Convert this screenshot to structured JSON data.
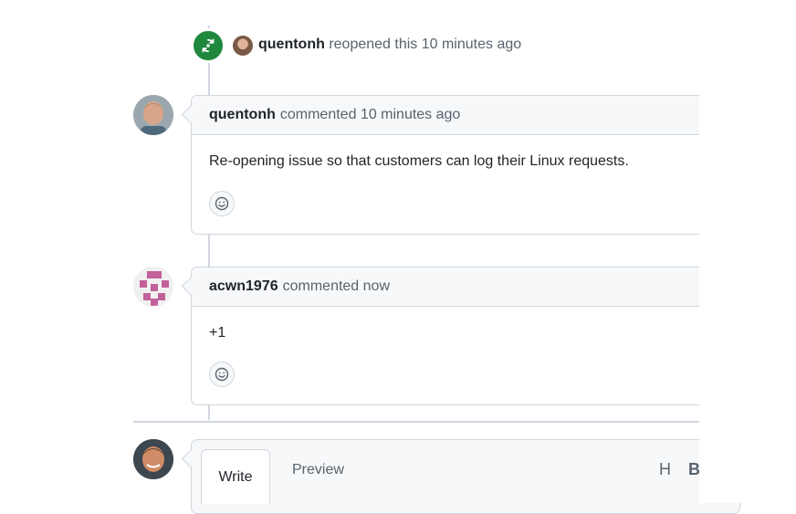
{
  "reopen_event": {
    "username": "quentonh",
    "action": "reopened this 10 minutes ago"
  },
  "comments": [
    {
      "username": "quentonh",
      "meta": "commented 10 minutes ago",
      "body": "Re-opening issue so that customers can log their Linux requests."
    },
    {
      "username": "acwn1976",
      "meta": "commented now",
      "body": "+1"
    }
  ],
  "editor": {
    "tab_write": "Write",
    "tab_preview": "Preview",
    "heading_tool": "H",
    "bold_tool": "B"
  },
  "icons": {
    "reopen": "sync-icon",
    "reaction": "smiley-icon"
  },
  "colors": {
    "reopen_badge": "#1f883d",
    "border": "#d0d7de",
    "header_bg": "#f6f8fa",
    "muted_text": "#59636e"
  }
}
